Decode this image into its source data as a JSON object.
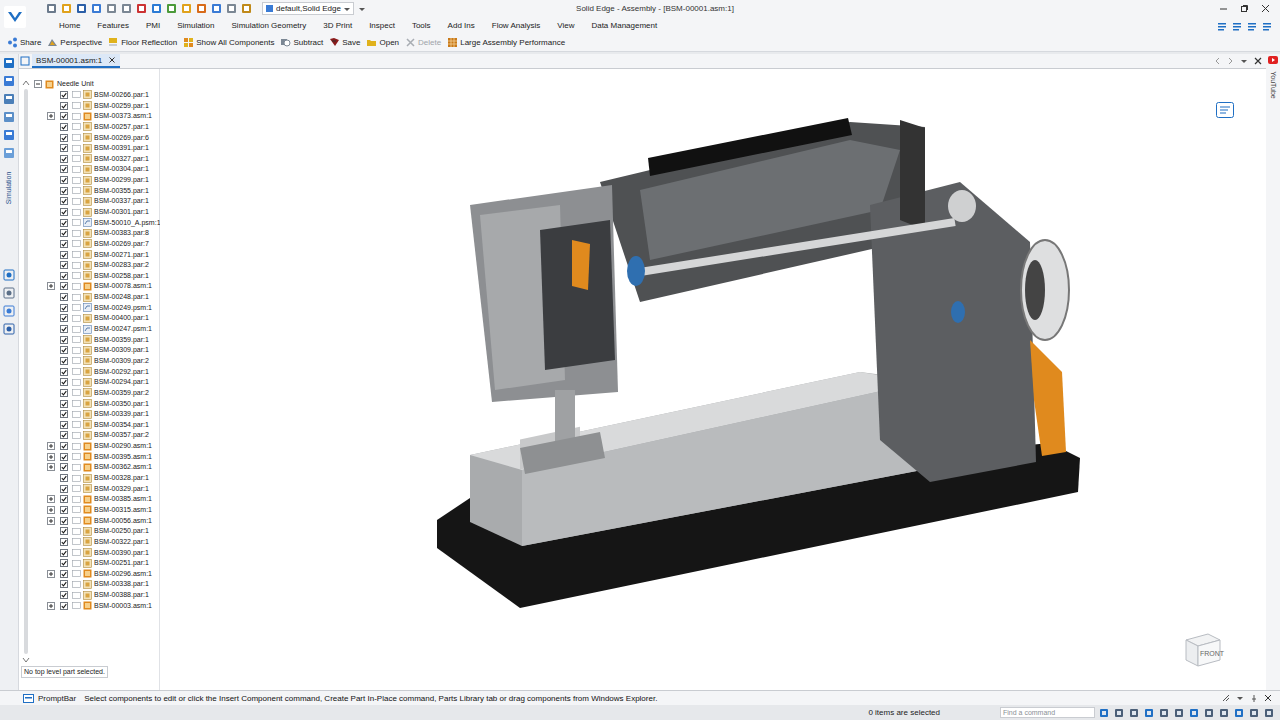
{
  "window": {
    "title": "Solid Edge - Assembly - [BSM-00001.asm:1]",
    "theme": "default,Solid Edge"
  },
  "menu": [
    {
      "label": "Home",
      "selected": false
    },
    {
      "label": "Features",
      "selected": false
    },
    {
      "label": "PMI",
      "selected": false
    },
    {
      "label": "Simulation",
      "selected": false
    },
    {
      "label": "Simulation Geometry",
      "selected": false
    },
    {
      "label": "3D Print",
      "selected": false
    },
    {
      "label": "Inspect",
      "selected": false
    },
    {
      "label": "Tools",
      "selected": false
    },
    {
      "label": "Add Ins",
      "selected": false
    },
    {
      "label": "Flow Analysis",
      "selected": false
    },
    {
      "label": "View",
      "selected": false
    },
    {
      "label": "Data Management",
      "selected": false
    }
  ],
  "toolbar": [
    {
      "label": "Share",
      "disabled": false
    },
    {
      "label": "Perspective",
      "disabled": false
    },
    {
      "label": "Floor Reflection",
      "disabled": false
    },
    {
      "label": "Show All Components",
      "disabled": false
    },
    {
      "label": "Subtract",
      "disabled": false
    },
    {
      "label": "Save",
      "disabled": false
    },
    {
      "label": "Open",
      "disabled": false
    },
    {
      "label": "Delete",
      "disabled": true
    },
    {
      "label": "Large Assembly Performance",
      "disabled": false
    }
  ],
  "document_tabs": [
    {
      "label": "BSM-00001.asm:1",
      "selected": true
    }
  ],
  "left_strip": {
    "label": "Simulation"
  },
  "right_strip": {
    "label": "YouTube"
  },
  "tree": {
    "root": {
      "label": "Needle Unit",
      "expanded": true
    },
    "items": [
      {
        "label": "BSM-00266.par:1",
        "kind": "part",
        "checked": true
      },
      {
        "label": "BSM-00259.par:1",
        "kind": "part",
        "checked": true
      },
      {
        "label": "BSM-00373.asm:1",
        "kind": "assembly",
        "checked": true
      },
      {
        "label": "BSM-00257.par:1",
        "kind": "part",
        "checked": true
      },
      {
        "label": "BSM-00269.par:6",
        "kind": "part",
        "checked": true
      },
      {
        "label": "BSM-00391.par:1",
        "kind": "part",
        "checked": true
      },
      {
        "label": "BSM-00327.par:1",
        "kind": "part",
        "checked": true
      },
      {
        "label": "BSM-00304.par:1",
        "kind": "part",
        "checked": true
      },
      {
        "label": "BSM-00299.par:1",
        "kind": "part",
        "checked": true
      },
      {
        "label": "BSM-00355.par:1",
        "kind": "part",
        "checked": true
      },
      {
        "label": "BSM-00337.par:1",
        "kind": "part",
        "checked": true
      },
      {
        "label": "BSM-00301.par:1",
        "kind": "part",
        "checked": true
      },
      {
        "label": "BSM-50010_A.psm:1",
        "kind": "sheet",
        "checked": true
      },
      {
        "label": "BSM-00383.par:8",
        "kind": "part",
        "checked": true
      },
      {
        "label": "BSM-00269.par:7",
        "kind": "part",
        "checked": true
      },
      {
        "label": "BSM-00271.par:1",
        "kind": "part",
        "checked": true
      },
      {
        "label": "BSM-00283.par:2",
        "kind": "part",
        "checked": true
      },
      {
        "label": "BSM-00258.par:1",
        "kind": "part",
        "checked": true
      },
      {
        "label": "BSM-00078.asm:1",
        "kind": "assembly",
        "checked": true
      },
      {
        "label": "BSM-00248.par:1",
        "kind": "part",
        "checked": true
      },
      {
        "label": "BSM-00249.psm:1",
        "kind": "sheet",
        "checked": true
      },
      {
        "label": "BSM-00400.par:1",
        "kind": "part",
        "checked": true
      },
      {
        "label": "BSM-00247.psm:1",
        "kind": "sheet",
        "checked": true
      },
      {
        "label": "BSM-00359.par:1",
        "kind": "part",
        "checked": true
      },
      {
        "label": "BSM-00309.par:1",
        "kind": "part",
        "checked": true
      },
      {
        "label": "BSM-00309.par:2",
        "kind": "part",
        "checked": true
      },
      {
        "label": "BSM-00292.par:1",
        "kind": "part",
        "checked": true
      },
      {
        "label": "BSM-00294.par:1",
        "kind": "part",
        "checked": true
      },
      {
        "label": "BSM-00359.par:2",
        "kind": "part",
        "checked": true
      },
      {
        "label": "BSM-00350.par:1",
        "kind": "part",
        "checked": true
      },
      {
        "label": "BSM-00339.par:1",
        "kind": "part",
        "checked": true
      },
      {
        "label": "BSM-00354.par:1",
        "kind": "part",
        "checked": true
      },
      {
        "label": "BSM-00357.par:2",
        "kind": "part",
        "checked": true
      },
      {
        "label": "BSM-00290.asm:1",
        "kind": "assembly",
        "checked": true
      },
      {
        "label": "BSM-00395.asm:1",
        "kind": "assembly",
        "checked": true
      },
      {
        "label": "BSM-00362.asm:1",
        "kind": "assembly",
        "checked": true
      },
      {
        "label": "BSM-00328.par:1",
        "kind": "part",
        "checked": true
      },
      {
        "label": "BSM-00329.par:1",
        "kind": "part",
        "checked": true
      },
      {
        "label": "BSM-00385.asm:1",
        "kind": "assembly",
        "checked": true
      },
      {
        "label": "BSM-00315.asm:1",
        "kind": "assembly",
        "checked": true
      },
      {
        "label": "BSM-00056.asm:1",
        "kind": "assembly",
        "checked": true
      },
      {
        "label": "BSM-00250.par:1",
        "kind": "part",
        "checked": true
      },
      {
        "label": "BSM-00322.par:1",
        "kind": "part",
        "checked": true
      },
      {
        "label": "BSM-00390.par:1",
        "kind": "part",
        "checked": true
      },
      {
        "label": "BSM-00251.par:1",
        "kind": "part",
        "checked": true
      },
      {
        "label": "BSM-00296.asm:1",
        "kind": "assembly",
        "checked": true
      },
      {
        "label": "BSM-00338.par:1",
        "kind": "part",
        "checked": true
      },
      {
        "label": "BSM-00388.par:1",
        "kind": "part",
        "checked": true
      },
      {
        "label": "BSM-00003.asm:1",
        "kind": "assembly",
        "checked": true
      }
    ],
    "status": "No top level part selected."
  },
  "view_cube": {
    "face": "FRONT"
  },
  "prompt_bar": {
    "label": "PromptBar",
    "text": "Select components to edit or click the Insert Component command, Create Part In-Place command, Parts Library tab or drag components from Windows Explorer."
  },
  "status_bar": {
    "selection": "0 items are selected",
    "search": {
      "placeholder": "Find a command"
    }
  }
}
